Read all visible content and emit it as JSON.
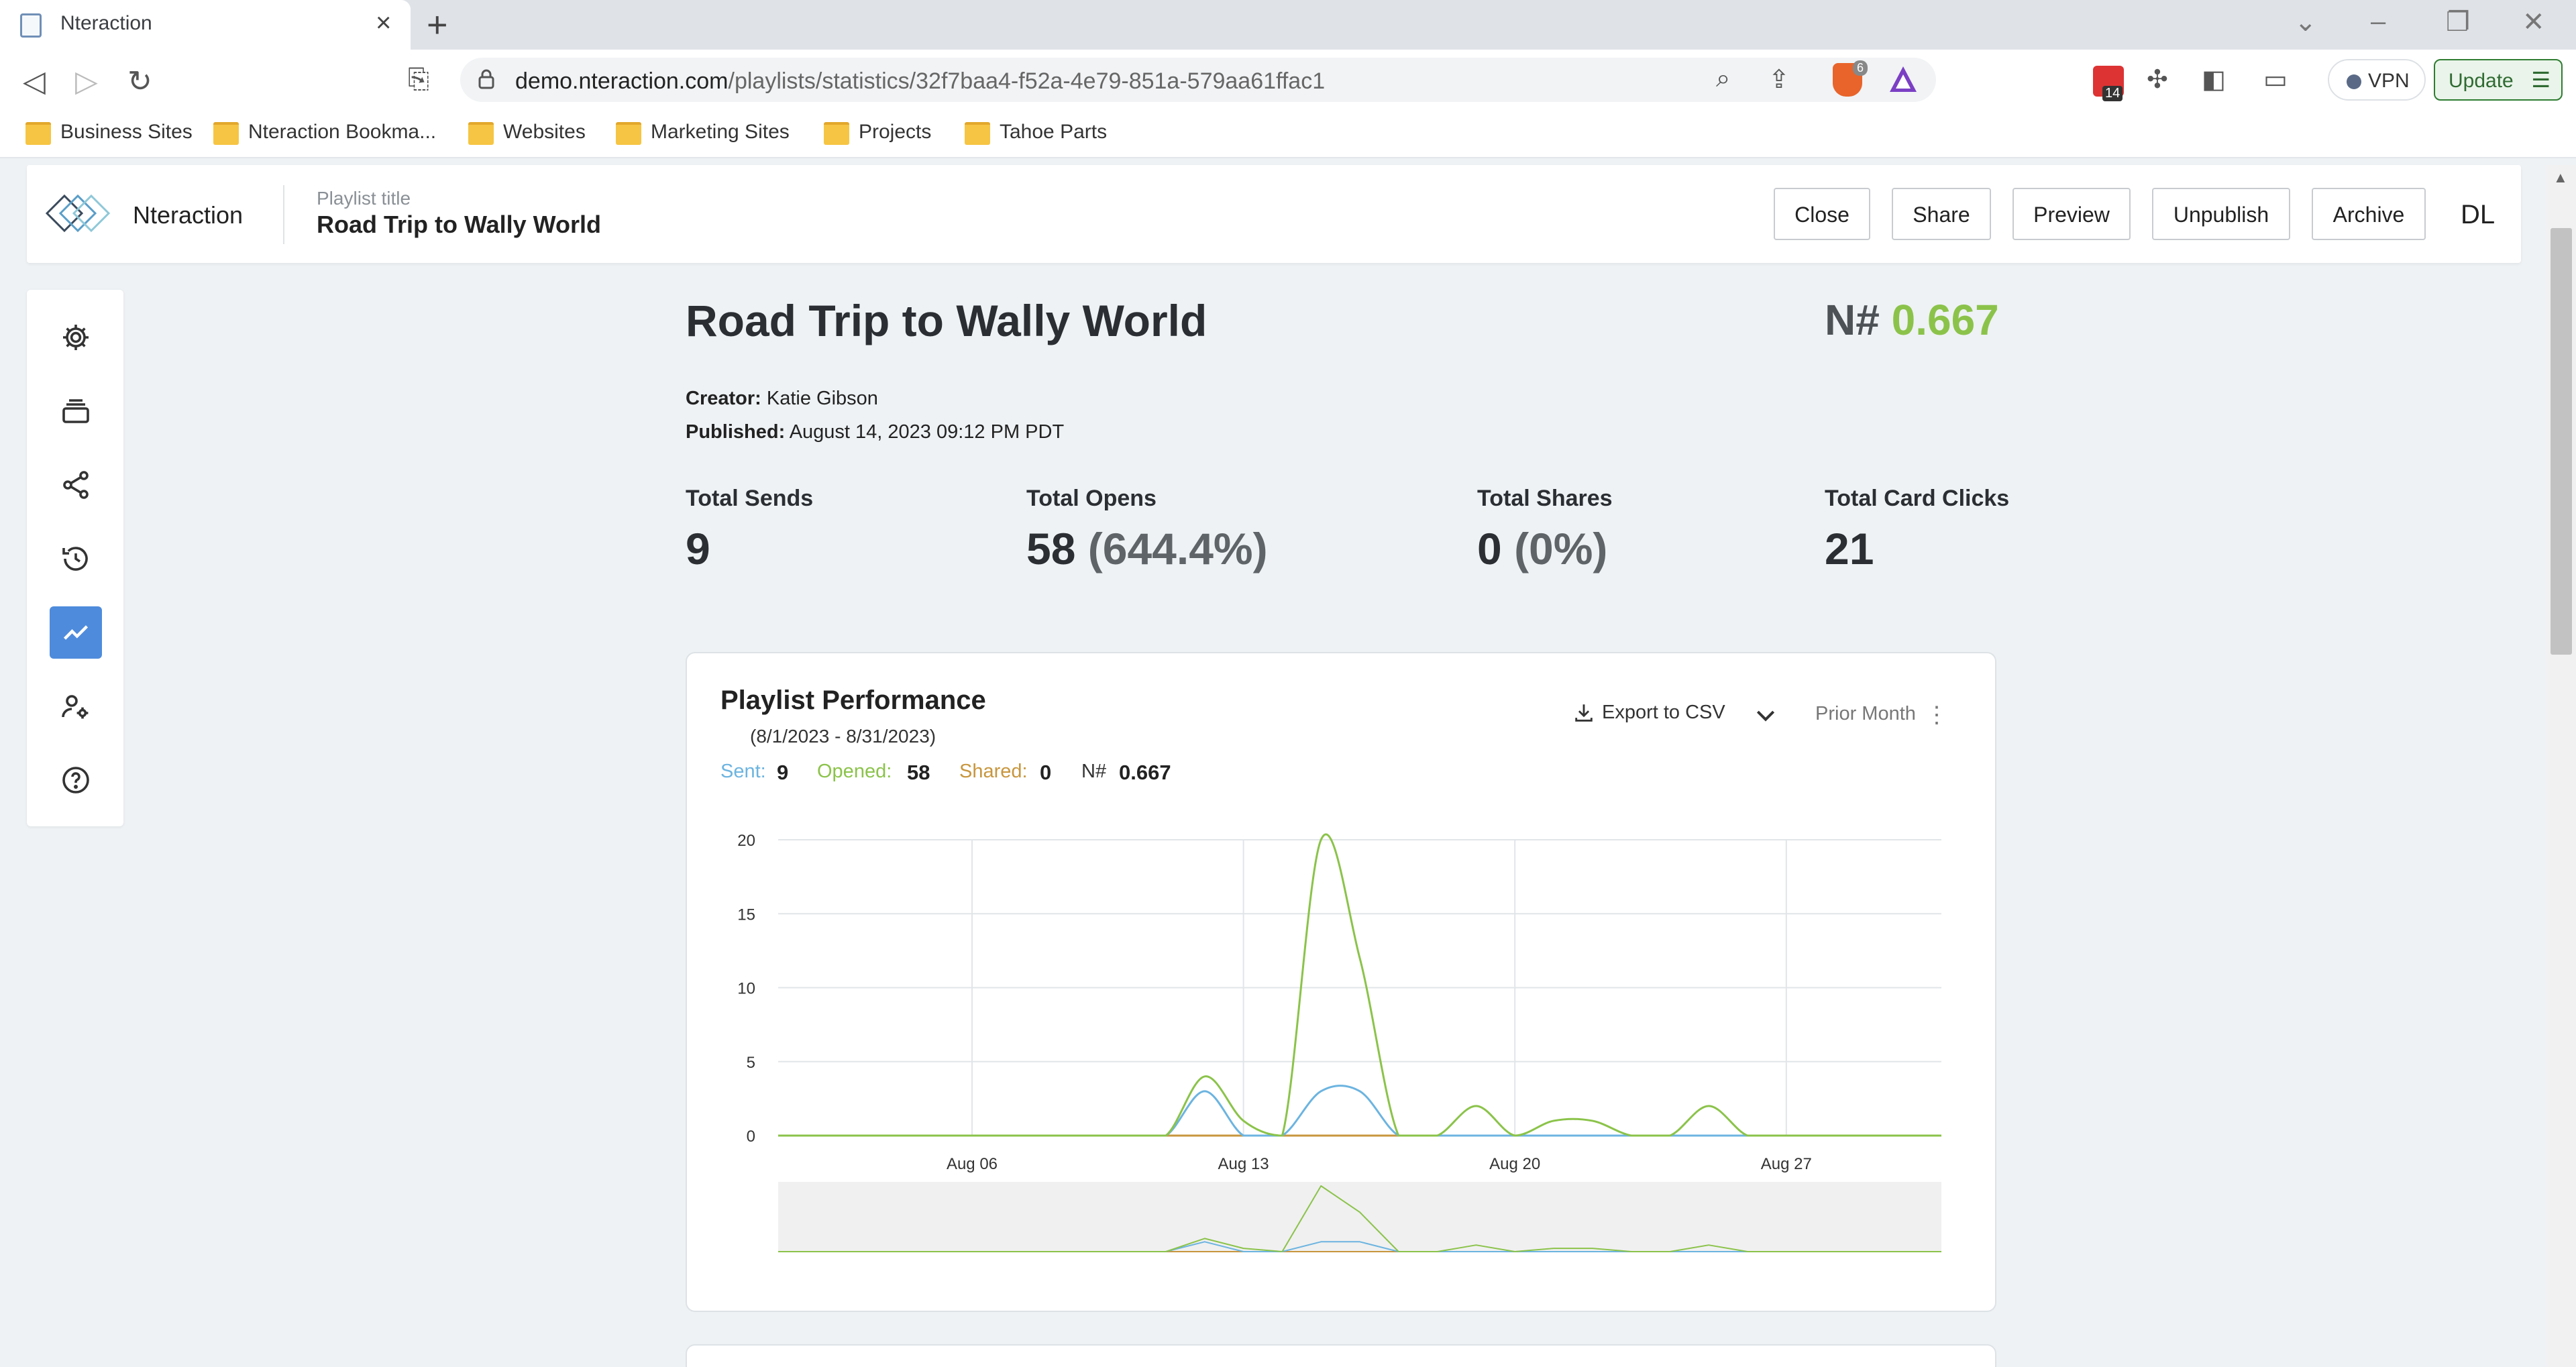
{
  "browser": {
    "tab_title": "Nteraction",
    "url_host": "demo.nteraction.com",
    "url_path": "/playlists/statistics/32f7baa4-f52a-4e79-851a-579aa61ffac1",
    "vpn_label": "VPN",
    "update_label": "Update",
    "extension_badge": "14",
    "shield_badge": "6",
    "bookmarks": [
      "Business Sites",
      "Nteraction Bookma...",
      "Websites",
      "Marketing Sites",
      "Projects",
      "Tahoe Parts"
    ]
  },
  "header": {
    "brand": "Nteraction",
    "playlist_label": "Playlist title",
    "playlist_title": "Road Trip to Wally World",
    "buttons": {
      "close": "Close",
      "share": "Share",
      "preview": "Preview",
      "unpublish": "Unpublish",
      "archive": "Archive"
    },
    "user_initials": "DL"
  },
  "sidebar": {
    "icons": [
      "gear-icon",
      "layers-icon",
      "share-icon",
      "history-icon",
      "trending-icon",
      "user-settings-icon",
      "help-icon"
    ],
    "active": "trending-icon"
  },
  "page": {
    "title": "Road Trip to Wally World",
    "score_label": "N#",
    "score_value": "0.667",
    "creator_label": "Creator:",
    "creator": "Katie Gibson",
    "published_label": "Published:",
    "published": "August 14, 2023 09:12 PM PDT",
    "stats": {
      "sends_label": "Total Sends",
      "sends": "9",
      "opens_label": "Total Opens",
      "opens": "58",
      "opens_pct": "(644.4%)",
      "shares_label": "Total Shares",
      "shares": "0",
      "shares_pct": "(0%)",
      "clicks_label": "Total Card Clicks",
      "clicks": "21"
    }
  },
  "card": {
    "title": "Playlist Performance",
    "range": "(8/1/2023 - 8/31/2023)",
    "export_label": "Export to CSV",
    "period_label": "Prior Month",
    "legend": {
      "sent_label": "Sent:",
      "sent": "9",
      "opened_label": "Opened:",
      "opened": "58",
      "shared_label": "Shared:",
      "shared": "0",
      "n_label": "N#",
      "n": "0.667"
    }
  },
  "colors": {
    "sent": "#6cb4e0",
    "opened": "#8bc34a",
    "shared": "#c8963e",
    "accent": "#4e8bdc"
  },
  "chart_data": {
    "type": "line",
    "x": [
      "2023-08-01",
      "2023-08-02",
      "2023-08-03",
      "2023-08-04",
      "2023-08-05",
      "2023-08-06",
      "2023-08-07",
      "2023-08-08",
      "2023-08-09",
      "2023-08-10",
      "2023-08-11",
      "2023-08-12",
      "2023-08-13",
      "2023-08-14",
      "2023-08-15",
      "2023-08-16",
      "2023-08-17",
      "2023-08-18",
      "2023-08-19",
      "2023-08-20",
      "2023-08-21",
      "2023-08-22",
      "2023-08-23",
      "2023-08-24",
      "2023-08-25",
      "2023-08-26",
      "2023-08-27",
      "2023-08-28",
      "2023-08-29",
      "2023-08-30",
      "2023-08-31"
    ],
    "series": [
      {
        "name": "Opened",
        "values": [
          0,
          0,
          0,
          0,
          0,
          0,
          0,
          0,
          0,
          0,
          0,
          4,
          1,
          0,
          20,
          12,
          0,
          0,
          2,
          0,
          1,
          1,
          0,
          0,
          2,
          0,
          0,
          0,
          0,
          0,
          0
        ]
      },
      {
        "name": "Sent",
        "values": [
          0,
          0,
          0,
          0,
          0,
          0,
          0,
          0,
          0,
          0,
          0,
          3,
          0,
          0,
          3,
          3,
          0,
          0,
          0,
          0,
          0,
          0,
          0,
          0,
          0,
          0,
          0,
          0,
          0,
          0,
          0
        ]
      },
      {
        "name": "Shared",
        "values": [
          0,
          0,
          0,
          0,
          0,
          0,
          0,
          0,
          0,
          0,
          0,
          0,
          0,
          0,
          0,
          0,
          0,
          0,
          0,
          0,
          0,
          0,
          0,
          0,
          0,
          0,
          0,
          0,
          0,
          0,
          0
        ]
      }
    ],
    "ylim": [
      0,
      20
    ],
    "yticks": [
      0,
      5,
      10,
      15,
      20
    ],
    "xticks": [
      "Aug 06",
      "Aug 13",
      "Aug 20",
      "Aug 27"
    ],
    "grid": true
  }
}
